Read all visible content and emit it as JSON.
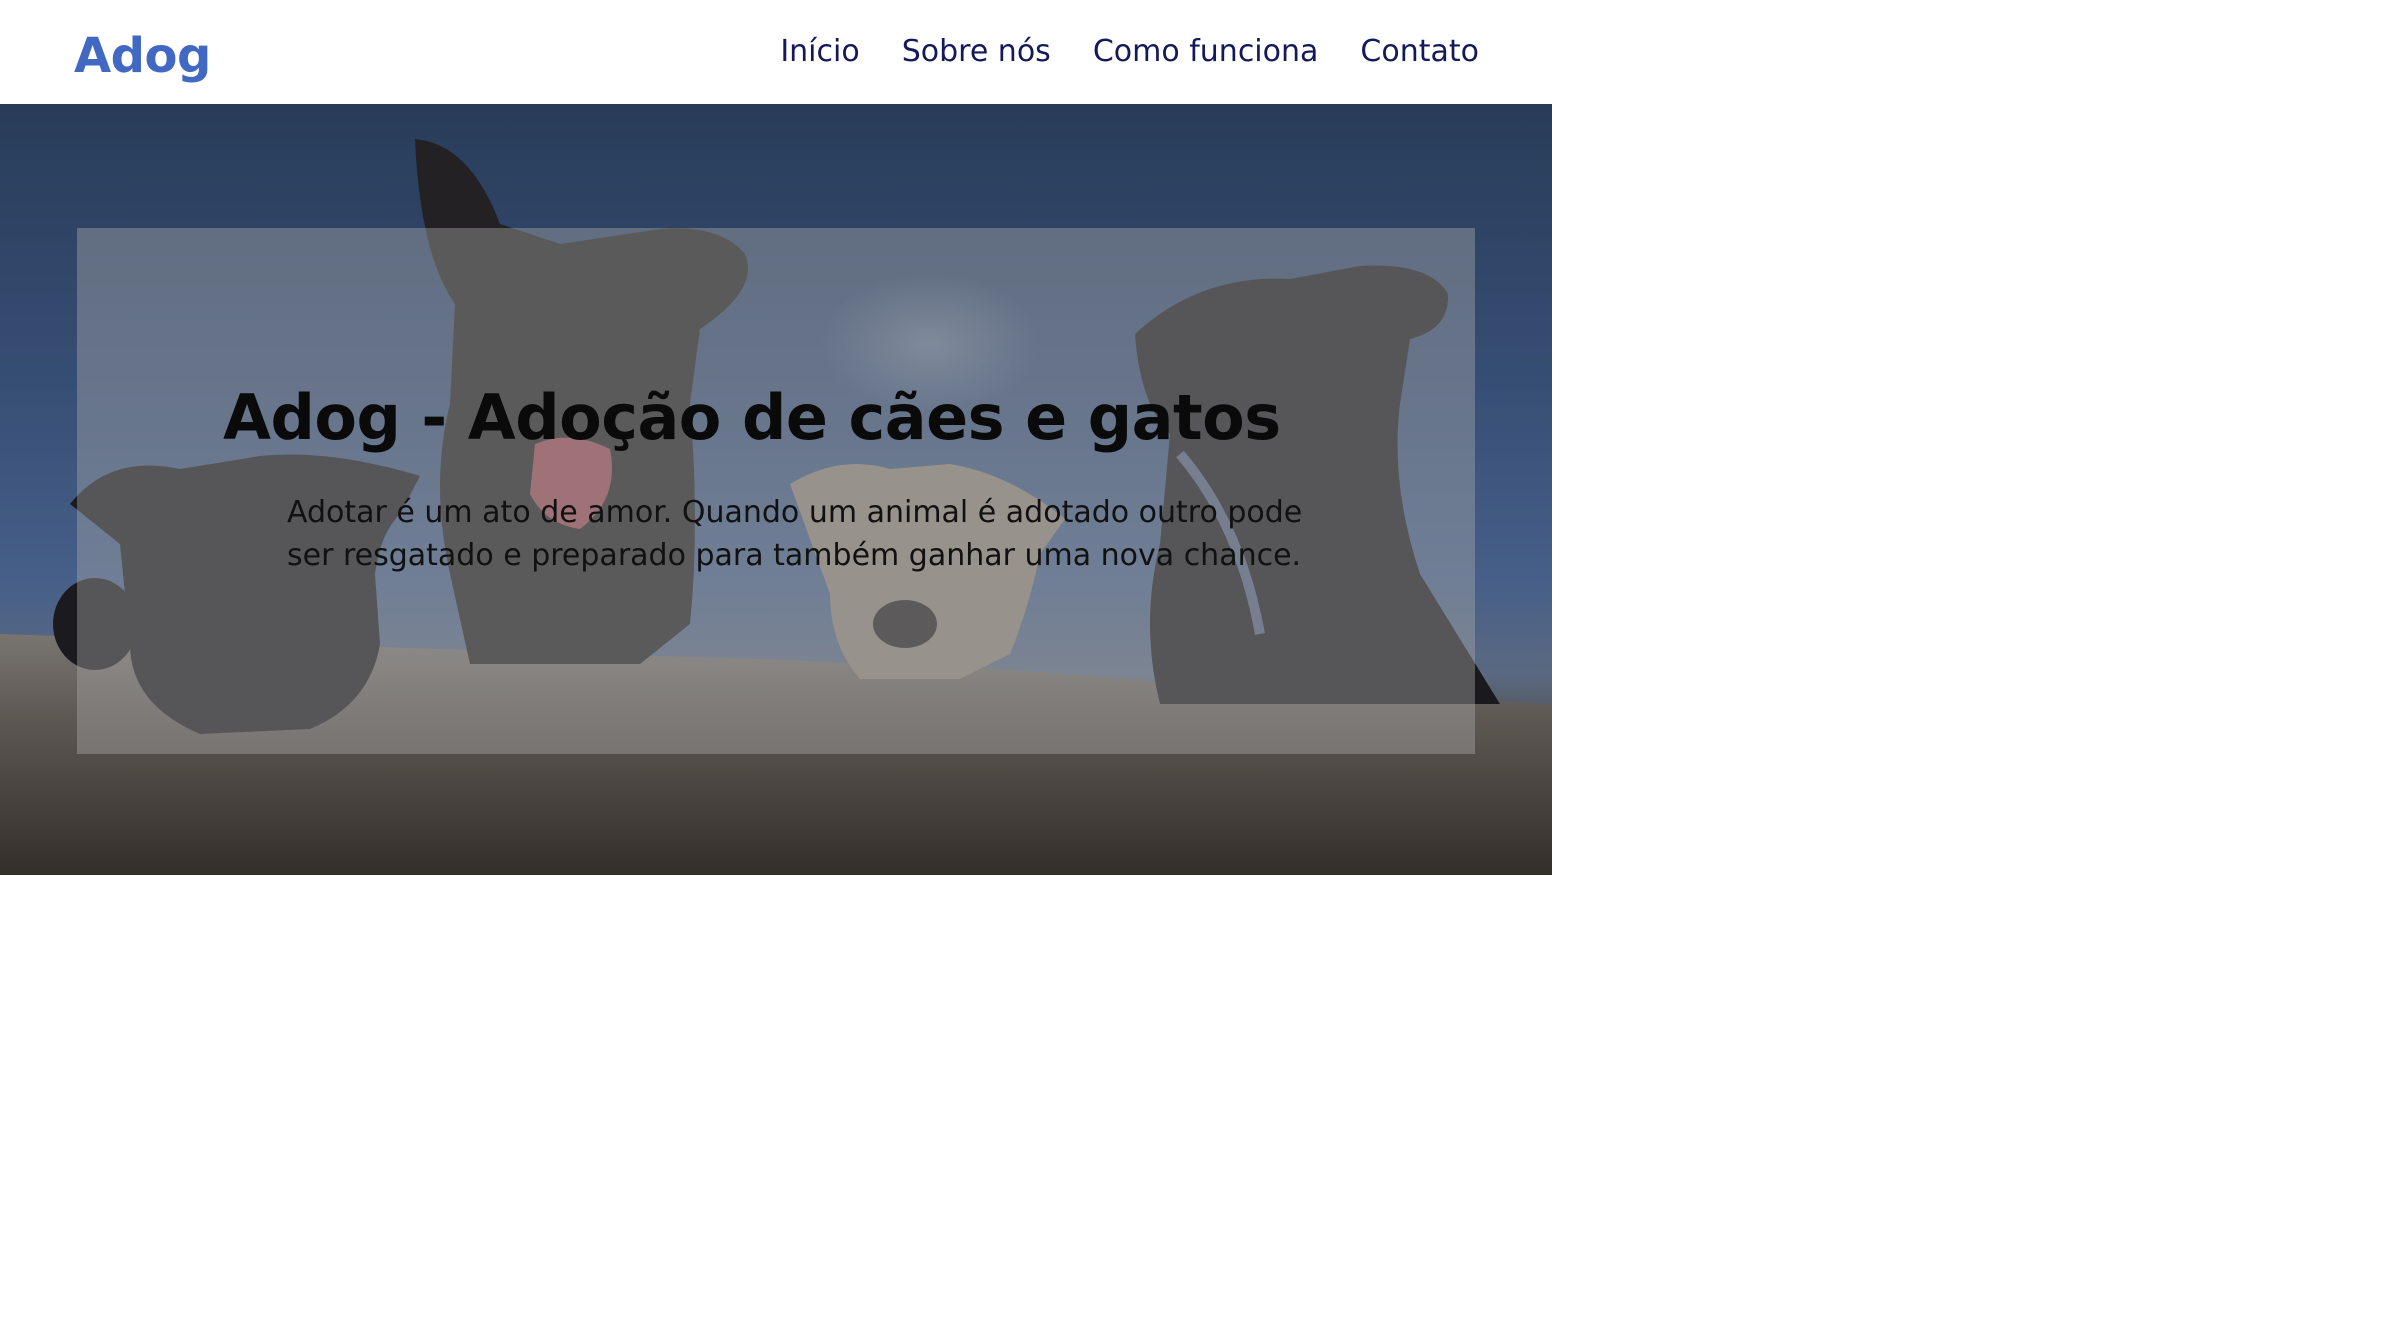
{
  "header": {
    "logo": "Adog",
    "nav": [
      {
        "label": "Início"
      },
      {
        "label": "Sobre nós"
      },
      {
        "label": "Como funciona"
      },
      {
        "label": "Contato"
      }
    ]
  },
  "hero": {
    "image_description_icon": "dogs-photo",
    "title": "Adog - Adoção de cães e gatos",
    "text": "Adotar é um ato de amor. Quando um animal é adotado outro pode ser resgatado e preparado para também ganhar uma nova chance."
  },
  "colors": {
    "logo": "#4169c4",
    "nav_text": "#14195a",
    "sky": "#3e5a86",
    "panel": "rgba(170,170,170,0.42)"
  }
}
